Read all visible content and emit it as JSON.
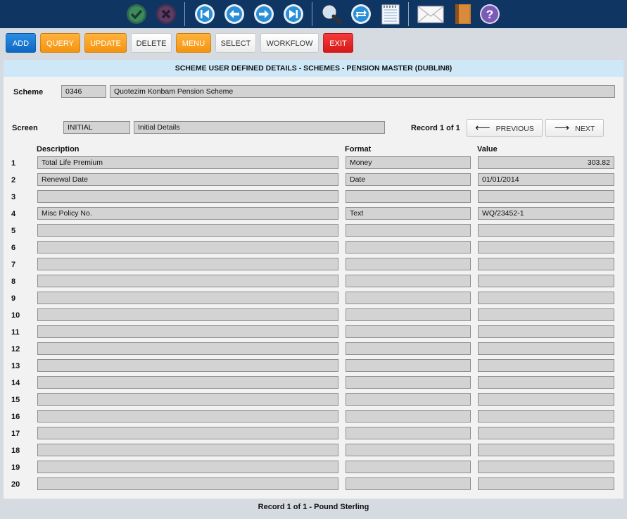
{
  "toolbar": {
    "icons": [
      "confirm-icon",
      "cancel-icon",
      "first-record-icon",
      "previous-record-icon",
      "next-record-icon",
      "last-record-icon",
      "search-icon",
      "refresh-icon",
      "notepad-icon",
      "mail-icon",
      "book-icon",
      "help-icon"
    ]
  },
  "actions": {
    "add": "ADD",
    "query": "QUERY",
    "update": "UPDATE",
    "delete": "DELETE",
    "menu": "MENU",
    "select": "SELECT",
    "workflow": "WORKFLOW",
    "exit": "EXIT"
  },
  "panel": {
    "title": "SCHEME USER DEFINED DETAILS - SCHEMES - PENSION MASTER (DUBLIN8)",
    "scheme_label": "Scheme",
    "scheme_code": "0346",
    "scheme_name": "Quotezim Konbam Pension Scheme",
    "screen_label": "Screen",
    "screen_code": "INITIAL",
    "screen_name": "Initial Details",
    "record_info": "Record 1 of 1",
    "previous_label": "PREVIOUS",
    "next_label": "NEXT",
    "col_description": "Description",
    "col_format": "Format",
    "col_value": "Value"
  },
  "rows": [
    {
      "num": "1",
      "description": "Total Life Premium",
      "format": "Money",
      "value": "303.82"
    },
    {
      "num": "2",
      "description": "Renewal Date",
      "format": "Date",
      "value": "01/01/2014"
    },
    {
      "num": "3",
      "description": "",
      "format": "",
      "value": ""
    },
    {
      "num": "4",
      "description": "Misc Policy No.",
      "format": "Text",
      "value": "WQ/23452-1"
    },
    {
      "num": "5",
      "description": "",
      "format": "",
      "value": ""
    },
    {
      "num": "6",
      "description": "",
      "format": "",
      "value": ""
    },
    {
      "num": "7",
      "description": "",
      "format": "",
      "value": ""
    },
    {
      "num": "8",
      "description": "",
      "format": "",
      "value": ""
    },
    {
      "num": "9",
      "description": "",
      "format": "",
      "value": ""
    },
    {
      "num": "10",
      "description": "",
      "format": "",
      "value": ""
    },
    {
      "num": "11",
      "description": "",
      "format": "",
      "value": ""
    },
    {
      "num": "12",
      "description": "",
      "format": "",
      "value": ""
    },
    {
      "num": "13",
      "description": "",
      "format": "",
      "value": ""
    },
    {
      "num": "14",
      "description": "",
      "format": "",
      "value": ""
    },
    {
      "num": "15",
      "description": "",
      "format": "",
      "value": ""
    },
    {
      "num": "16",
      "description": "",
      "format": "",
      "value": ""
    },
    {
      "num": "17",
      "description": "",
      "format": "",
      "value": ""
    },
    {
      "num": "18",
      "description": "",
      "format": "",
      "value": ""
    },
    {
      "num": "19",
      "description": "",
      "format": "",
      "value": ""
    },
    {
      "num": "20",
      "description": "",
      "format": "",
      "value": ""
    }
  ],
  "footer": {
    "status": "Record 1 of 1 - Pound Sterling"
  }
}
